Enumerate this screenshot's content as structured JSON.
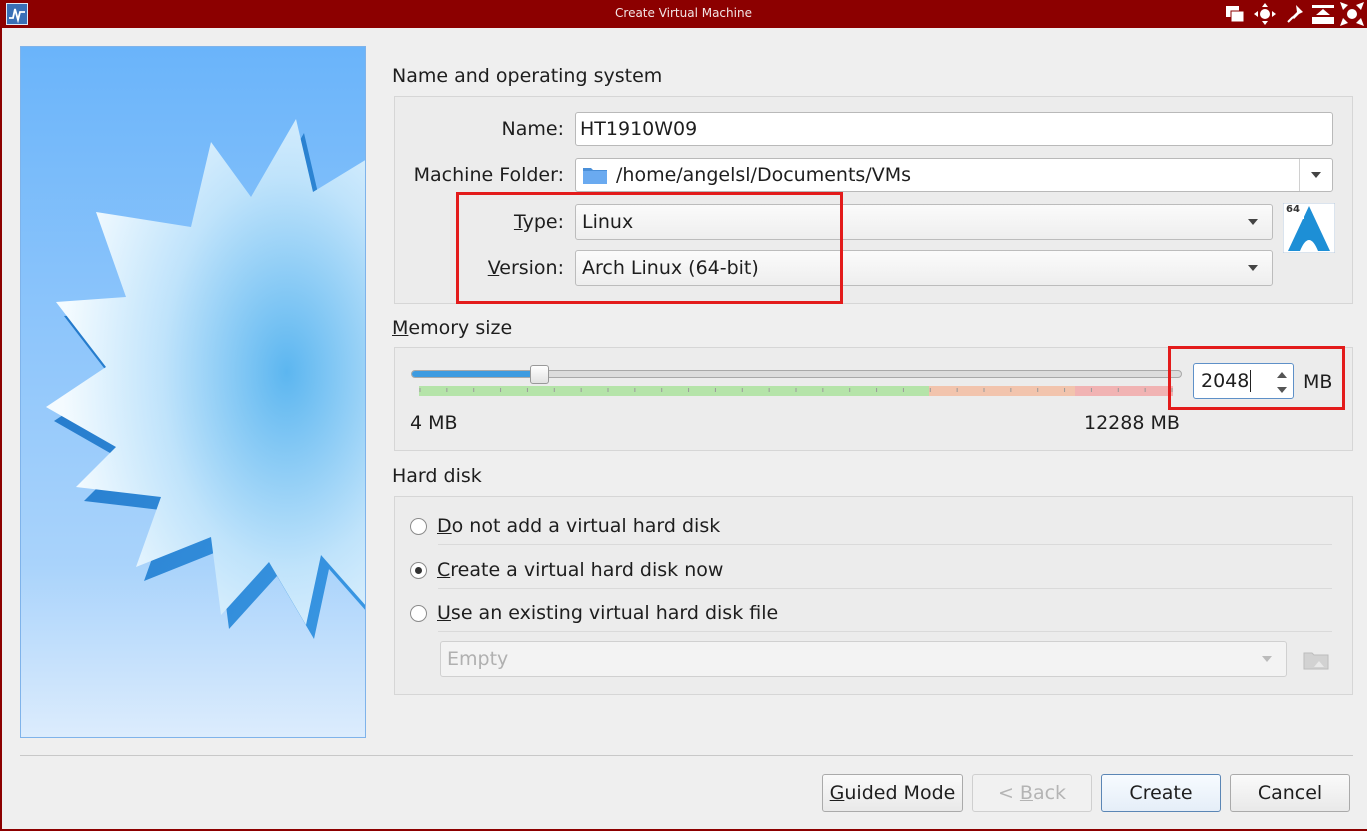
{
  "window": {
    "title": "Create Virtual Machine",
    "controls": [
      "restore-icon",
      "move-icon",
      "pin-icon",
      "shade-icon",
      "close-icon"
    ]
  },
  "name_os": {
    "section_title": "Name and operating system",
    "name_label": "Name:",
    "name_value": "HT1910W09",
    "folder_label": "Machine Folder:",
    "folder_value": "/home/angelsl/Documents/VMs",
    "type_label_prefix": "T",
    "type_label_rest": "ype:",
    "type_value": "Linux",
    "version_label_prefix": "V",
    "version_label_rest": "ersion:",
    "version_value": "Arch Linux (64-bit)",
    "os_badge": "64"
  },
  "memory": {
    "section_title_prefix": "M",
    "section_title_rest": "emory size",
    "slider_fraction": 0.166,
    "min_label": "4 MB",
    "max_label": "12288 MB",
    "value": "2048",
    "unit": "MB"
  },
  "hard_disk": {
    "section_title": "Hard disk",
    "options": [
      {
        "prefix": "D",
        "rest": "o not add a virtual hard disk",
        "checked": false
      },
      {
        "prefix": "C",
        "rest": "reate a virtual hard disk now",
        "checked": true
      },
      {
        "prefix": "U",
        "rest": "se an existing virtual hard disk file",
        "checked": false
      }
    ],
    "file_placeholder": "Empty"
  },
  "buttons": {
    "guided_prefix": "G",
    "guided_rest": "uided Mode",
    "back_pre": "< ",
    "back_prefix": "B",
    "back_rest": "ack",
    "create": "Create",
    "cancel": "Cancel"
  },
  "colors": {
    "titlebar": "#8c0000",
    "highlight": "#e31b1b",
    "slider_fill": "#3d9be0",
    "mem_green": "#b5e4a9",
    "mem_orange": "#f2c4ad",
    "mem_red": "#f1b3b3"
  }
}
